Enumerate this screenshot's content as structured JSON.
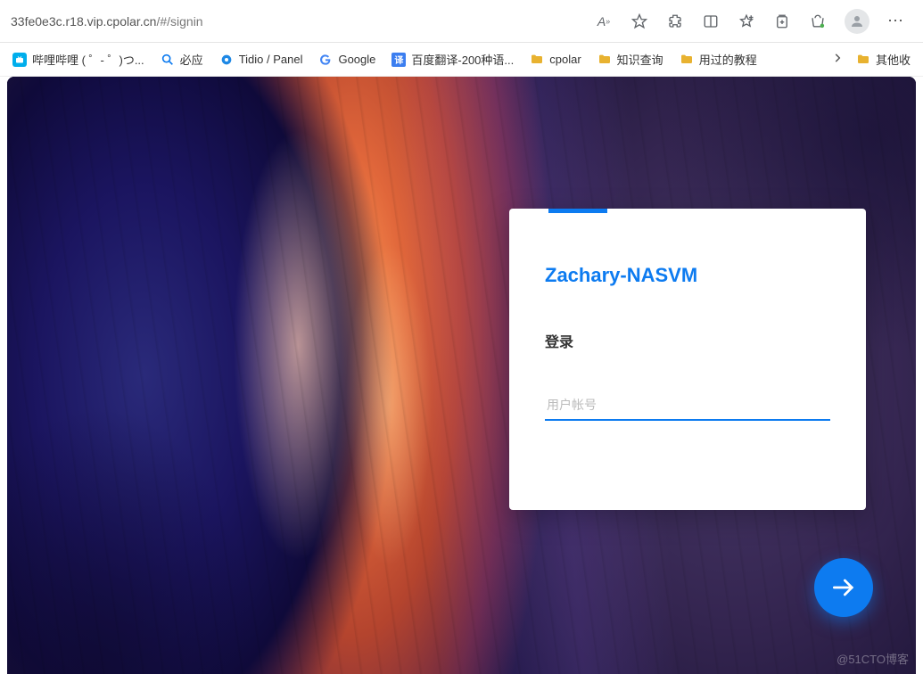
{
  "browser": {
    "url_host": "33fe0e3c.r18.vip.cpolar.cn",
    "url_path": "/#/signin",
    "icons": {
      "read": "A",
      "star": "star",
      "ext": "extension",
      "split": "sidebar",
      "fav": "favorites",
      "collections": "collections",
      "shopping": "shopping",
      "more": "⋯"
    }
  },
  "bookmarks": {
    "items": [
      {
        "label": "哔哩哔哩 ( ゜- ゜)つ...",
        "icon": "bilibili",
        "color": "#00aeec"
      },
      {
        "label": "必应",
        "icon": "search",
        "color": "#0d7bf0"
      },
      {
        "label": "Tidio / Panel",
        "icon": "tidio",
        "color": "#1e88e5"
      },
      {
        "label": "Google",
        "icon": "google",
        "color": ""
      },
      {
        "label": "百度翻译-200种语...",
        "icon": "translate",
        "color": "#3b7ef0"
      },
      {
        "label": "cpolar",
        "icon": "folder",
        "color": "#e8b230"
      },
      {
        "label": "知识查询",
        "icon": "folder",
        "color": "#e8b230"
      },
      {
        "label": "用过的教程",
        "icon": "folder",
        "color": "#e8b230"
      }
    ],
    "overflow_label": "其他收"
  },
  "login": {
    "brand": "Zachary-NASVM",
    "title": "登录",
    "username_placeholder": "用户帐号"
  },
  "watermark": "@51CTO博客"
}
